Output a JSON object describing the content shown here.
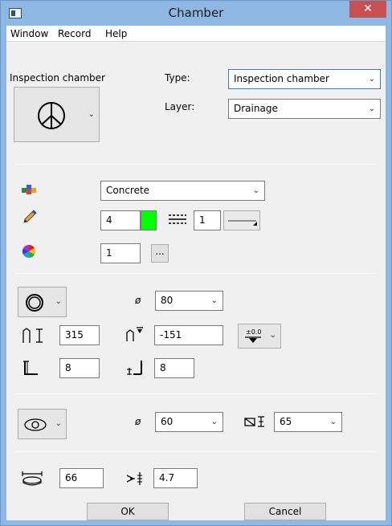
{
  "window": {
    "title": "Chamber",
    "close_glyph": "✕"
  },
  "menu": {
    "items": [
      "Window",
      "Record",
      "Help"
    ]
  },
  "header": {
    "symbol_label": "Inspection chamber",
    "type_label": "Type:",
    "type_value": "Inspection chamber",
    "layer_label": "Layer:",
    "layer_value": "Drainage"
  },
  "material": {
    "value": "Concrete",
    "icon": "material-blocks-icon"
  },
  "pen": {
    "color_number": "4",
    "color_swatch": "#00ff00",
    "linetype_number": "1",
    "icon": "pencil-icon"
  },
  "color_layer": {
    "value": "1",
    "more_label": "...",
    "icon": "color-wheel-icon"
  },
  "chamber": {
    "shape_icon": "ring-circle-icon",
    "diameter_symbol": "ø",
    "diameter_value": "80",
    "height_value": "315",
    "top_level_value": "-151",
    "wall_thickness_value": "8",
    "base_thickness_value": "8"
  },
  "cover": {
    "shape_icon": "eye-oval-icon",
    "diameter_symbol": "ø",
    "diameter_value": "60",
    "thickness_value": "65"
  },
  "bottom": {
    "width_value": "66",
    "depth_value": "4.7"
  },
  "buttons": {
    "ok": "OK",
    "cancel": "Cancel"
  },
  "colors": {
    "titlebar": "#8fb7e3",
    "close": "#c75050",
    "swatch": "#00ff00"
  }
}
